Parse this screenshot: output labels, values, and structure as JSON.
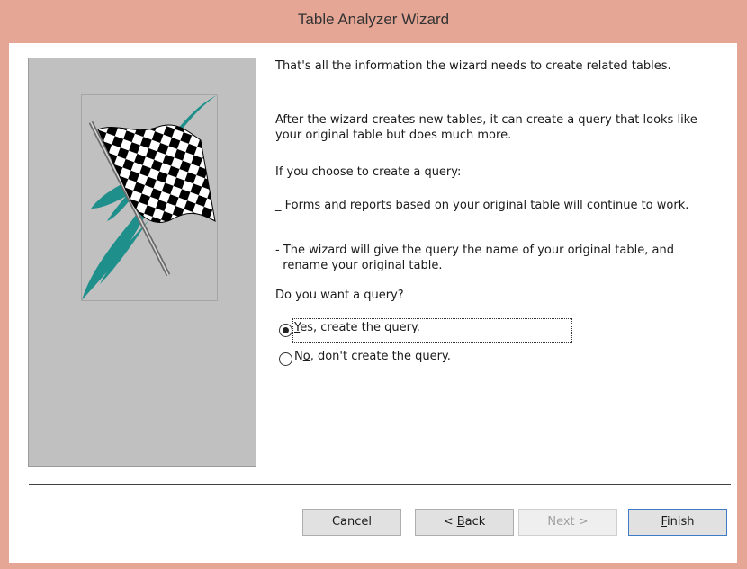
{
  "window": {
    "title": "Table Analyzer Wizard"
  },
  "content": {
    "intro": "That's all the information the wizard needs to create related tables.",
    "para1_line1": "After the wizard creates new tables, it can create a query that looks like",
    "para1_line2": "your original table but does much more.",
    "choose": "If you choose to create a query:",
    "bullet1": "_ Forms and reports based on your original table will continue to work.",
    "bullet2_line1": "- The wizard will give the query the name of your original table, and",
    "bullet2_line2": "  rename your original table.",
    "question": "Do you want a query?"
  },
  "options": [
    {
      "mnemonic": "Y",
      "rest": "es, create the query.",
      "selected": true
    },
    {
      "mnemonic": "o",
      "prefix": "N",
      "rest": ", don't create the query.",
      "selected": false
    }
  ],
  "buttons": {
    "cancel": "Cancel",
    "back_prefix": "< ",
    "back_mnemonic": "B",
    "back_rest": "ack",
    "next": "Next >",
    "finish_mnemonic": "F",
    "finish_rest": "inish"
  },
  "colors": {
    "titlebar": "#e6a695",
    "panel": "#c0c0c0",
    "flag_accent": "#1f8f8c"
  },
  "icons": {
    "picture": "checkered-flag-icon"
  }
}
